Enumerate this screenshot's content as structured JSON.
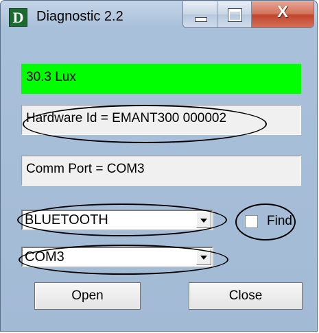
{
  "window": {
    "title": "Diagnostic 2.2",
    "icon_letter": "D",
    "controls": {
      "minimize_icon": "minimize-icon",
      "maximize_icon": "maximize-icon",
      "close_icon": "close-icon",
      "close_glyph": "X"
    }
  },
  "readouts": {
    "lux": "30.3 Lux",
    "hardware_id": "Hardware Id = EMANT300 000002",
    "comm_port": "Comm Port = COM3"
  },
  "connection": {
    "type_selected": "BLUETOOTH",
    "port_selected": "COM3",
    "find_label": "Find",
    "find_checked": false
  },
  "buttons": {
    "open": "Open",
    "close": "Close"
  },
  "colors": {
    "lux_background": "#00ff00",
    "annotation": "#000000"
  }
}
